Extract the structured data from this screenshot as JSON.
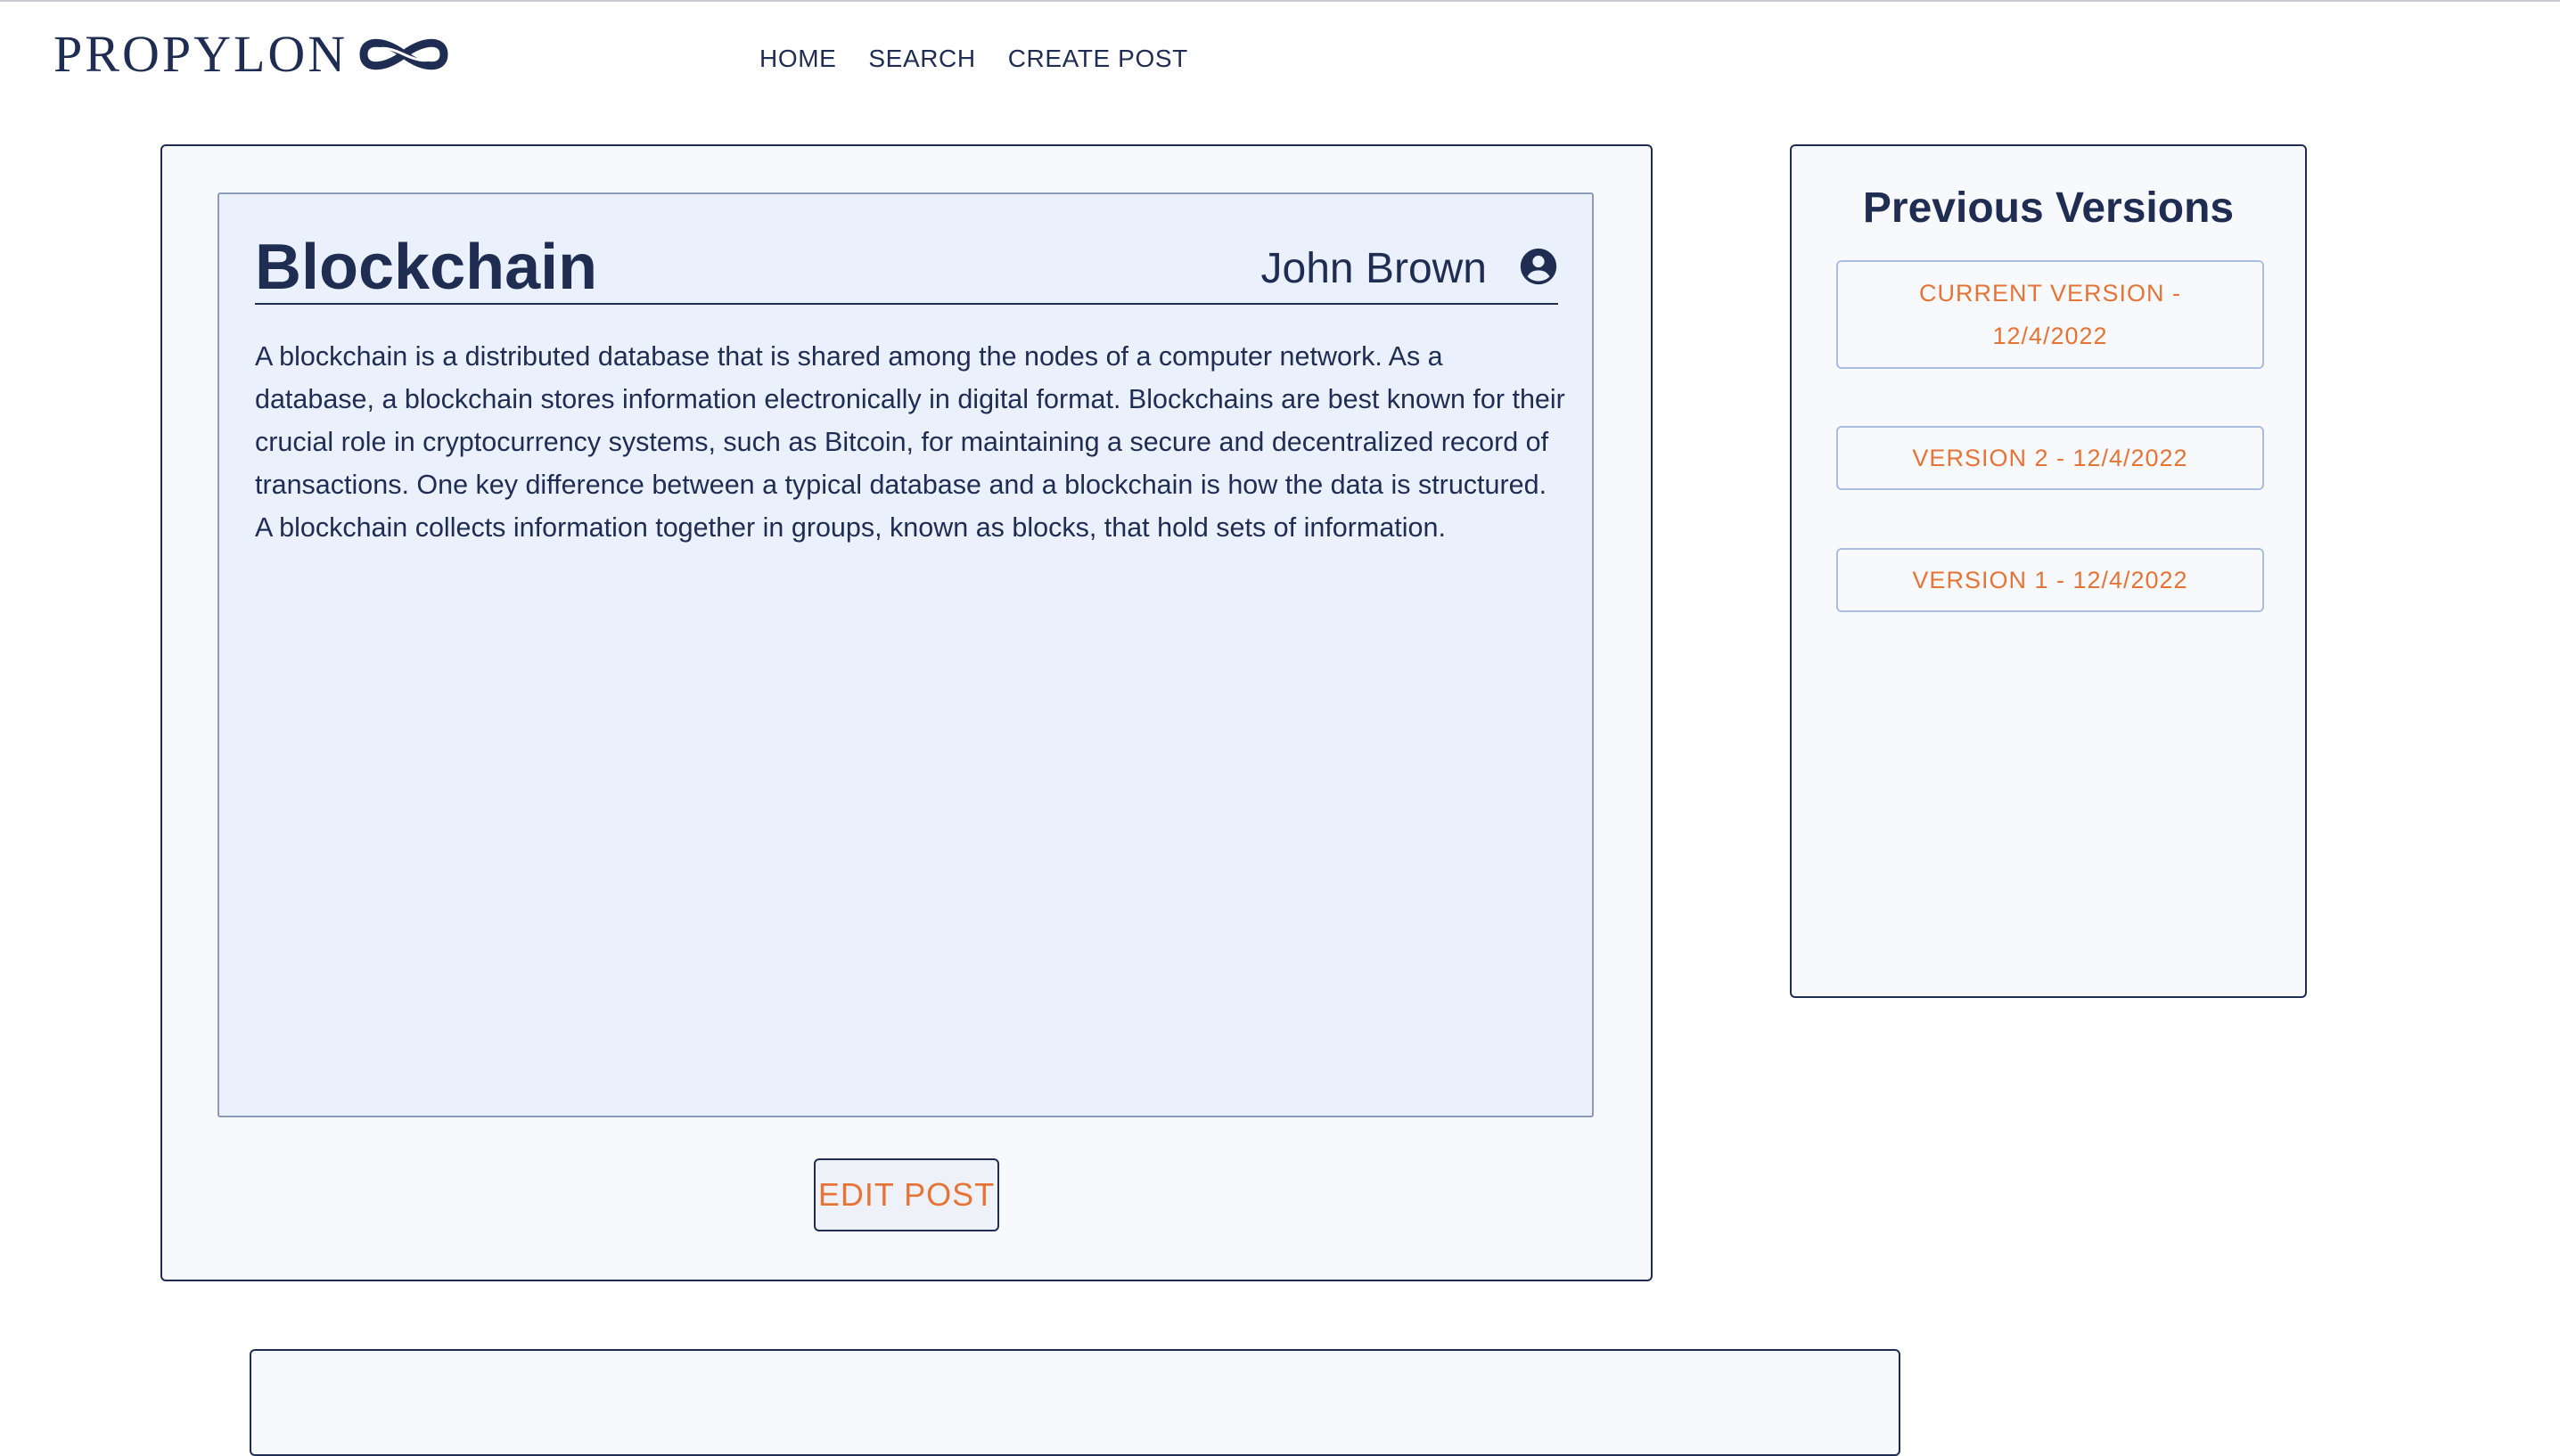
{
  "header": {
    "logo_text": "PROPYLON",
    "logo_icon": "infinity-knot-icon",
    "nav": [
      {
        "label": "HOME"
      },
      {
        "label": "SEARCH"
      },
      {
        "label": "CREATE POST"
      }
    ]
  },
  "post": {
    "title": "Blockchain",
    "author": "John Brown",
    "author_icon": "account-circle-icon",
    "body": "A blockchain is a distributed database that is shared among the nodes of a computer network. As a database, a blockchain stores information electronically in digital format. Blockchains are best known for their crucial role in cryptocurrency systems, such as Bitcoin, for maintaining a secure and decentralized record of transactions. One key difference between a typical database and a blockchain is how the data is structured. A blockchain collects information together in groups, known as blocks, that hold sets of information.",
    "edit_label": "EDIT POST"
  },
  "versions": {
    "title": "Previous Versions",
    "items": [
      {
        "label": "CURRENT VERSION - 12/4/2022"
      },
      {
        "label": "VERSION 2 - 12/4/2022"
      },
      {
        "label": "VERSION 1 - 12/4/2022"
      }
    ]
  },
  "colors": {
    "navy": "#1f2d52",
    "accent_orange": "#e57436",
    "panel_bg": "#f7f9fd",
    "content_bg": "#eaf1fc"
  }
}
